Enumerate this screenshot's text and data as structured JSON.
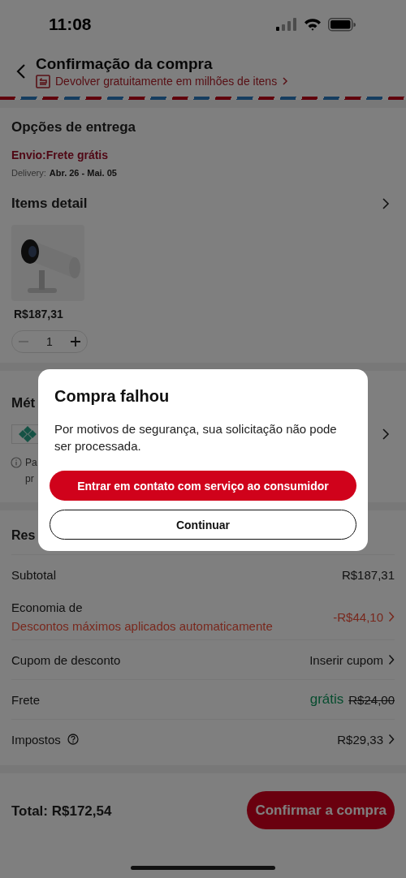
{
  "status_bar": {
    "time": "11:08"
  },
  "header": {
    "title": "Confirmação da compra",
    "return_link": "Devolver gratuitamente em milhões de itens"
  },
  "delivery": {
    "title": "Opções de entrega",
    "shipping": "Envio:Frete grátis",
    "delivery_label": "Delivery:",
    "delivery_dates": "Abr. 26 - Mai. 05"
  },
  "items_detail": {
    "title": "Items detail",
    "items": [
      {
        "price": "R$187,31",
        "quantity": "1",
        "decrease_disabled": true
      }
    ]
  },
  "payment": {
    "title": "Mét",
    "note_lines": [
      "Pa",
      "pr"
    ]
  },
  "summary": {
    "title": "Res",
    "rows": [
      {
        "kind": "plain",
        "label": "Subtotal",
        "value": "R$187,31",
        "chevron": false,
        "help": false
      },
      {
        "kind": "discount",
        "label": "Economia de",
        "sublabel": "Descontos máximos aplicados automaticamente",
        "value": "-R$44,10",
        "chevron": true,
        "help": false
      },
      {
        "kind": "plain",
        "label": "Cupom de desconto",
        "value": "Inserir cupom",
        "chevron": true,
        "help": false
      },
      {
        "kind": "free",
        "label": "Frete",
        "value": "grátis",
        "old_value": "R$24,00",
        "chevron": false,
        "help": false
      },
      {
        "kind": "plain",
        "label": "Impostos",
        "value": "R$29,33",
        "chevron": true,
        "help": true
      }
    ]
  },
  "footer": {
    "total": "Total: R$172,54",
    "confirm_button": "Confirmar a compra"
  },
  "dialog": {
    "title": "Compra falhou",
    "message": "Por motivos de segurança, sua solicitação não pode ser processada.",
    "primary_button": "Entrar em contato com serviço ao consumidor",
    "secondary_button": "Continuar"
  }
}
